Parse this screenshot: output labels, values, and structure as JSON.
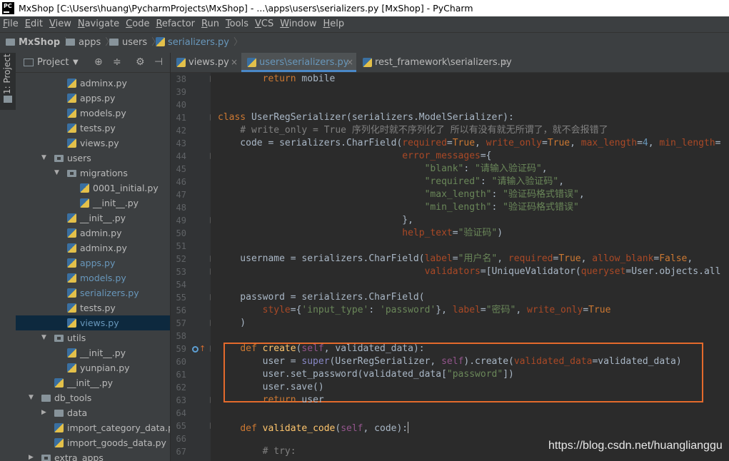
{
  "window": {
    "title": "MxShop [C:\\Users\\huang\\PycharmProjects\\MxShop] - ...\\apps\\users\\serializers.py [MxShop] - PyCharm",
    "logo": "PC"
  },
  "menu": [
    "File",
    "Edit",
    "View",
    "Navigate",
    "Code",
    "Refactor",
    "Run",
    "Tools",
    "VCS",
    "Window",
    "Help"
  ],
  "breadcrumb": [
    "MxShop",
    "apps",
    "users",
    "serializers.py"
  ],
  "tool_strip": {
    "label": "1: Project"
  },
  "project_panel": {
    "title": "Project",
    "caret": "▼"
  },
  "tree": [
    {
      "label": "adminx.py",
      "kind": "py",
      "indent": 3
    },
    {
      "label": "apps.py",
      "kind": "py",
      "indent": 3
    },
    {
      "label": "models.py",
      "kind": "py",
      "indent": 3
    },
    {
      "label": "tests.py",
      "kind": "py",
      "indent": 3
    },
    {
      "label": "views.py",
      "kind": "py",
      "indent": 3
    },
    {
      "label": "users",
      "kind": "pkg",
      "indent": 2,
      "arrow": "▼"
    },
    {
      "label": "migrations",
      "kind": "pkg",
      "indent": 3,
      "arrow": "▼"
    },
    {
      "label": "0001_initial.py",
      "kind": "py",
      "indent": 4
    },
    {
      "label": "__init__.py",
      "kind": "py",
      "indent": 4
    },
    {
      "label": "__init__.py",
      "kind": "py",
      "indent": 3
    },
    {
      "label": "admin.py",
      "kind": "py",
      "indent": 3
    },
    {
      "label": "adminx.py",
      "kind": "py",
      "indent": 3
    },
    {
      "label": "apps.py",
      "kind": "py",
      "indent": 3,
      "modified": true
    },
    {
      "label": "models.py",
      "kind": "py",
      "indent": 3,
      "modified": true
    },
    {
      "label": "serializers.py",
      "kind": "py",
      "indent": 3,
      "modified": true
    },
    {
      "label": "tests.py",
      "kind": "py",
      "indent": 3
    },
    {
      "label": "views.py",
      "kind": "py",
      "indent": 3,
      "modified": true,
      "selected": true
    },
    {
      "label": "utils",
      "kind": "pkg",
      "indent": 2,
      "arrow": "▼"
    },
    {
      "label": "__init__.py",
      "kind": "py",
      "indent": 3
    },
    {
      "label": "yunpian.py",
      "kind": "py",
      "indent": 3
    },
    {
      "label": "__init__.py",
      "kind": "py",
      "indent": 2
    },
    {
      "label": "db_tools",
      "kind": "folder",
      "indent": 1,
      "arrow": "▼"
    },
    {
      "label": "data",
      "kind": "folder",
      "indent": 2,
      "arrow": "▶"
    },
    {
      "label": "import_category_data.py",
      "kind": "py",
      "indent": 2
    },
    {
      "label": "import_goods_data.py",
      "kind": "py",
      "indent": 2
    },
    {
      "label": "extra_apps",
      "kind": "pkg",
      "indent": 1,
      "arrow": "▶"
    }
  ],
  "tabs": [
    {
      "label": "views.py",
      "active": false,
      "close": "×"
    },
    {
      "label": "users\\serializers.py",
      "active": true,
      "close": "×"
    },
    {
      "label": "rest_framework\\serializers.py",
      "active": false,
      "close": "×"
    }
  ],
  "code_lines": [
    {
      "n": "38",
      "t": [
        [
          "        ",
          ""
        ],
        [
          "return",
          "kw"
        ],
        [
          " mobile",
          ""
        ]
      ]
    },
    {
      "n": "39",
      "t": []
    },
    {
      "n": "40",
      "t": []
    },
    {
      "n": "41",
      "t": [
        [
          "class",
          "kw"
        ],
        [
          " UserRegSerializer(serializers.ModelSerializer):",
          ""
        ]
      ]
    },
    {
      "n": "42",
      "t": [
        [
          "    # write_only = True 序列化时就不序列化了 所以有没有就无所谓了，就不会报错了",
          "cmt"
        ]
      ]
    },
    {
      "n": "43",
      "t": [
        [
          "    code = serializers.CharField(",
          ""
        ],
        [
          "required",
          "param"
        ],
        [
          "=",
          ""
        ],
        [
          "True",
          "kw"
        ],
        [
          ", ",
          ""
        ],
        [
          "write_only",
          "param"
        ],
        [
          "=",
          ""
        ],
        [
          "True",
          "kw"
        ],
        [
          ", ",
          ""
        ],
        [
          "max_length",
          "param"
        ],
        [
          "=",
          ""
        ],
        [
          "4",
          "num"
        ],
        [
          ", ",
          ""
        ],
        [
          "min_length",
          "param"
        ],
        [
          "=",
          ""
        ]
      ]
    },
    {
      "n": "44",
      "t": [
        [
          "                                 ",
          ""
        ],
        [
          "error_messages",
          "param"
        ],
        [
          "={",
          ""
        ]
      ]
    },
    {
      "n": "45",
      "t": [
        [
          "                                     ",
          ""
        ],
        [
          "\"blank\"",
          "str"
        ],
        [
          ": ",
          ""
        ],
        [
          "\"请输入验证码\"",
          "str"
        ],
        [
          ",",
          ""
        ]
      ]
    },
    {
      "n": "46",
      "t": [
        [
          "                                     ",
          ""
        ],
        [
          "\"required\"",
          "str"
        ],
        [
          ": ",
          ""
        ],
        [
          "\"请输入验证码\"",
          "str"
        ],
        [
          ",",
          ""
        ]
      ]
    },
    {
      "n": "47",
      "t": [
        [
          "                                     ",
          ""
        ],
        [
          "\"max_length\"",
          "str"
        ],
        [
          ": ",
          ""
        ],
        [
          "\"验证码格式错误\"",
          "str"
        ],
        [
          ",",
          ""
        ]
      ]
    },
    {
      "n": "48",
      "t": [
        [
          "                                     ",
          ""
        ],
        [
          "\"min_length\"",
          "str"
        ],
        [
          ": ",
          ""
        ],
        [
          "\"验证码格式错误\"",
          "str"
        ]
      ]
    },
    {
      "n": "49",
      "t": [
        [
          "                                 },",
          ""
        ]
      ]
    },
    {
      "n": "50",
      "t": [
        [
          "                                 ",
          ""
        ],
        [
          "help_text",
          "param"
        ],
        [
          "=",
          ""
        ],
        [
          "\"验证码\"",
          "str"
        ],
        [
          ")",
          ""
        ]
      ]
    },
    {
      "n": "51",
      "t": []
    },
    {
      "n": "52",
      "t": [
        [
          "    username = serializers.CharField(",
          ""
        ],
        [
          "label",
          "param"
        ],
        [
          "=",
          ""
        ],
        [
          "\"用户名\"",
          "str"
        ],
        [
          ", ",
          ""
        ],
        [
          "required",
          "param"
        ],
        [
          "=",
          ""
        ],
        [
          "True",
          "kw"
        ],
        [
          ", ",
          ""
        ],
        [
          "allow_blank",
          "param"
        ],
        [
          "=",
          ""
        ],
        [
          "False",
          "kw"
        ],
        [
          ",",
          ""
        ]
      ]
    },
    {
      "n": "53",
      "t": [
        [
          "                                     ",
          ""
        ],
        [
          "validators",
          "param"
        ],
        [
          "=[UniqueValidator(",
          ""
        ],
        [
          "queryset",
          "param"
        ],
        [
          "=User.objects.all",
          ""
        ]
      ]
    },
    {
      "n": "54",
      "t": []
    },
    {
      "n": "55",
      "t": [
        [
          "    password = serializers.CharField(",
          ""
        ]
      ]
    },
    {
      "n": "56",
      "t": [
        [
          "        ",
          ""
        ],
        [
          "style",
          "param"
        ],
        [
          "={",
          ""
        ],
        [
          "'input_type'",
          "str"
        ],
        [
          ": ",
          ""
        ],
        [
          "'password'",
          "str"
        ],
        [
          "}, ",
          ""
        ],
        [
          "label",
          "param"
        ],
        [
          "=",
          ""
        ],
        [
          "\"密码\"",
          "str"
        ],
        [
          ", ",
          ""
        ],
        [
          "write_only",
          "param"
        ],
        [
          "=",
          ""
        ],
        [
          "True",
          "kw"
        ]
      ]
    },
    {
      "n": "57",
      "t": [
        [
          "    )",
          ""
        ]
      ]
    },
    {
      "n": "58",
      "t": []
    },
    {
      "n": "59",
      "t": [
        [
          "    ",
          ""
        ],
        [
          "def",
          "kw"
        ],
        [
          " ",
          ""
        ],
        [
          "create",
          "fn"
        ],
        [
          "(",
          ""
        ],
        [
          "self",
          "selfk"
        ],
        [
          ", validated_data):",
          ""
        ]
      ]
    },
    {
      "n": "60",
      "t": [
        [
          "        user = ",
          ""
        ],
        [
          "super",
          "builtin"
        ],
        [
          "(UserRegSerializer, ",
          ""
        ],
        [
          "self",
          "selfk"
        ],
        [
          ").create(",
          ""
        ],
        [
          "validated_data",
          "param"
        ],
        [
          "=validated_data)",
          ""
        ]
      ]
    },
    {
      "n": "61",
      "t": [
        [
          "        user.set_password(validated_data[",
          ""
        ],
        [
          "\"password\"",
          "str"
        ],
        [
          "])",
          ""
        ]
      ]
    },
    {
      "n": "62",
      "t": [
        [
          "        user.save()",
          ""
        ]
      ]
    },
    {
      "n": "63",
      "t": [
        [
          "        ",
          ""
        ],
        [
          "return",
          "kw"
        ],
        [
          " user",
          ""
        ]
      ]
    },
    {
      "n": "64",
      "t": []
    },
    {
      "n": "65",
      "t": [
        [
          "    ",
          ""
        ],
        [
          "def",
          "kw"
        ],
        [
          " ",
          ""
        ],
        [
          "validate_code",
          "fn"
        ],
        [
          "(",
          ""
        ],
        [
          "self",
          "selfk"
        ],
        [
          ", code):",
          ""
        ]
      ]
    },
    {
      "n": "66",
      "t": []
    },
    {
      "n": "67",
      "t": [
        [
          "        # try:",
          "cmt"
        ]
      ]
    }
  ],
  "watermark": "https://blog.csdn.net/huangliangg​u"
}
